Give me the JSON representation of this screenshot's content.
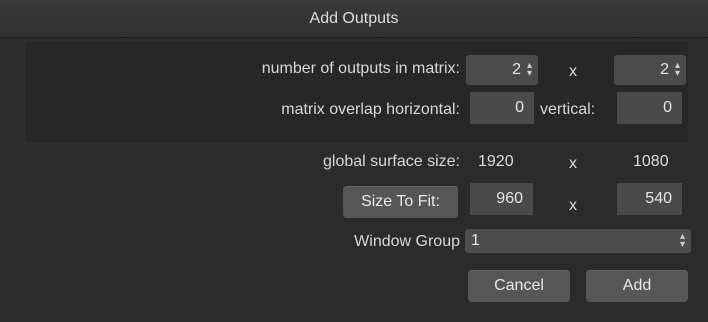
{
  "window": {
    "title": "Add Outputs"
  },
  "matrix": {
    "outputs_label": "number of outputs in matrix:",
    "outputs_x": "2",
    "separator": "x",
    "outputs_y": "2",
    "overlap_h_label": "matrix overlap horizontal:",
    "overlap_h": "0",
    "overlap_v_label": "vertical:",
    "overlap_v": "0"
  },
  "surface": {
    "global_label": "global surface size:",
    "global_w": "1920",
    "separator": "x",
    "global_h": "1080",
    "size_to_fit_label": "Size To Fit:",
    "fit_w": "960",
    "fit_separator": "x",
    "fit_h": "540"
  },
  "window_group": {
    "label": "Window Group",
    "selected": "1"
  },
  "buttons": {
    "cancel": "Cancel",
    "add": "Add"
  }
}
